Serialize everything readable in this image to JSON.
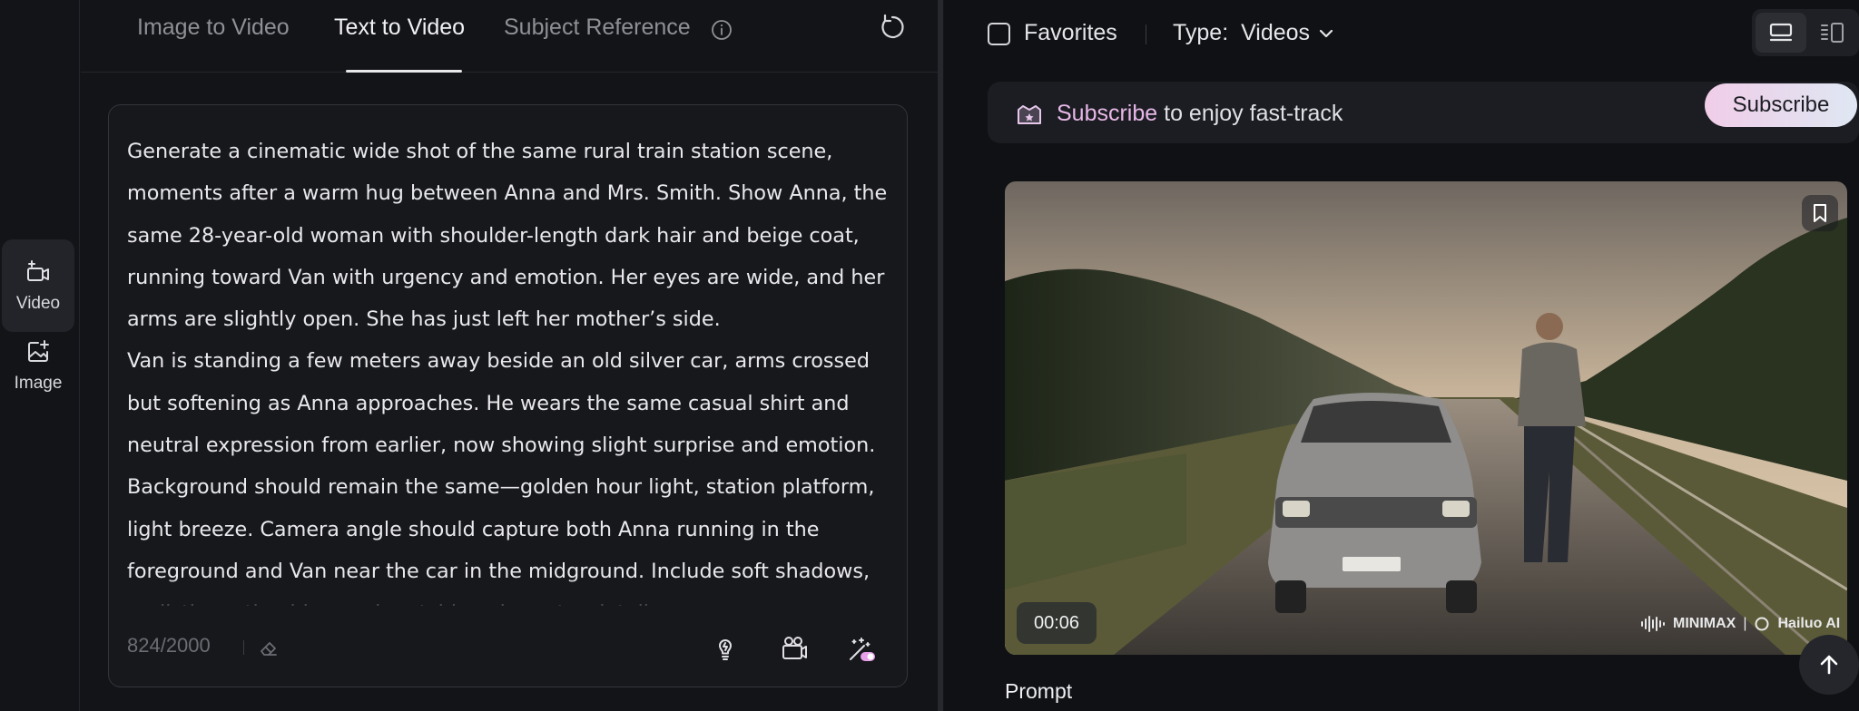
{
  "sidebar": {
    "items": [
      {
        "label": "Video",
        "icon": "video-plus-icon",
        "active": true
      },
      {
        "label": "Image",
        "icon": "image-plus-icon",
        "active": false
      }
    ]
  },
  "composer": {
    "tabs": [
      {
        "label": "Image to Video",
        "active": false
      },
      {
        "label": "Text to Video",
        "active": true
      },
      {
        "label": "Subject Reference",
        "active": false
      }
    ],
    "prompt": {
      "paragraphs": [
        " Generate a cinematic wide shot of the same rural train station scene, moments after a warm hug between Anna and Mrs. Smith. Show Anna, the same 28-year-old woman with shoulder-length dark hair and beige coat, running toward Van with urgency and emotion. Her eyes are wide, and her arms are slightly open. She has just left her mother’s side.",
        "Van is standing a few meters away beside an old silver car, arms crossed but softening as Anna approaches. He wears the same casual shirt and neutral expression from earlier, now showing slight surprise and emotion. Background should remain the same—golden hour light, station platform, light breeze. Camera angle should capture both Anna running in the foreground and Van near the car in the midground. Include soft shadows, realistic motion blur, and matching character details."
      ],
      "char_count": "824/2000"
    }
  },
  "results": {
    "favorites_label": "Favorites",
    "type_label": "Type:",
    "type_value": "Videos",
    "banner": {
      "link": "Subscribe",
      "text": " to enjoy fast-track",
      "button": "Subscribe"
    },
    "video": {
      "duration": "00:06",
      "watermark_left": "MINIMAX",
      "watermark_right": "Hailuo AI"
    },
    "prompt_heading": "Prompt"
  },
  "colors": {
    "background": "#131418",
    "accent_pink": "#e8b8e8",
    "text": "#e6e6e8"
  }
}
